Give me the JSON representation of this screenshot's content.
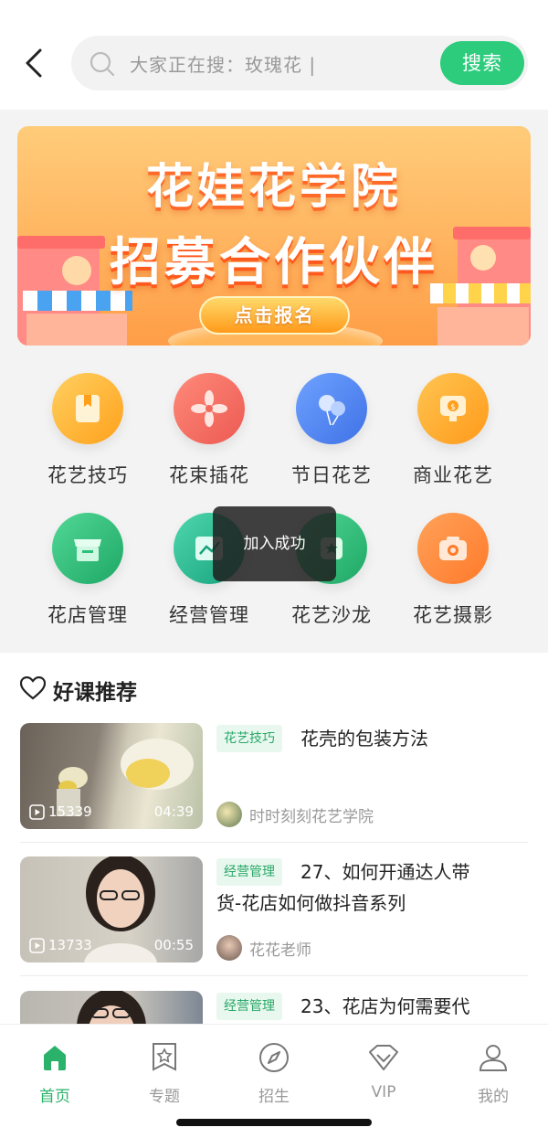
{
  "search": {
    "placeholder": "大家正在搜：玫瑰花 |",
    "button_label": "搜索"
  },
  "banner": {
    "title_line1": "花娃花学院",
    "title_line2": "招募合作伙伴",
    "cta_label": "点击报名"
  },
  "categories": [
    {
      "label": "花艺技巧",
      "icon": "bookmark-book-icon",
      "color": "#ffb42c"
    },
    {
      "label": "花束插花",
      "icon": "flower-icon",
      "color": "#f06a5c"
    },
    {
      "label": "节日花艺",
      "icon": "balloons-icon",
      "color": "#4f86f2"
    },
    {
      "label": "商业花艺",
      "icon": "coin-monitor-icon",
      "color": "#ffab2a"
    },
    {
      "label": "花店管理",
      "icon": "shop-icon",
      "color": "#2cbf7a"
    },
    {
      "label": "经营管理",
      "icon": "chart-icon",
      "color": "#22b08a"
    },
    {
      "label": "花艺沙龙",
      "icon": "salon-icon",
      "color": "#2cbf7a"
    },
    {
      "label": "花艺摄影",
      "icon": "camera-icon",
      "color": "#ff8a3a"
    }
  ],
  "toast": "加入成功",
  "section": {
    "title": "好课推荐"
  },
  "courses": [
    {
      "tag": "花艺技巧",
      "title": "花壳的包装方法",
      "views": "15339",
      "duration": "04:39",
      "author": "时时刻刻花艺学院"
    },
    {
      "tag": "经营管理",
      "title": "27、如何开通达人带货-花店如何做抖音系列",
      "views": "13733",
      "duration": "00:55",
      "author": "花花老师"
    },
    {
      "tag": "经营管理",
      "title": "23、花店为何需要代",
      "views": "",
      "duration": "",
      "author": ""
    }
  ],
  "tabbar": [
    {
      "label": "首页",
      "icon": "home-icon",
      "active": true
    },
    {
      "label": "专题",
      "icon": "star-bookmark-icon",
      "active": false
    },
    {
      "label": "招生",
      "icon": "compass-icon",
      "active": false
    },
    {
      "label": "VIP",
      "icon": "diamond-icon",
      "active": false
    },
    {
      "label": "我的",
      "icon": "user-icon",
      "active": false
    }
  ],
  "colors": {
    "accent": "#2ccc7c",
    "tab_active": "#2ab26a"
  }
}
